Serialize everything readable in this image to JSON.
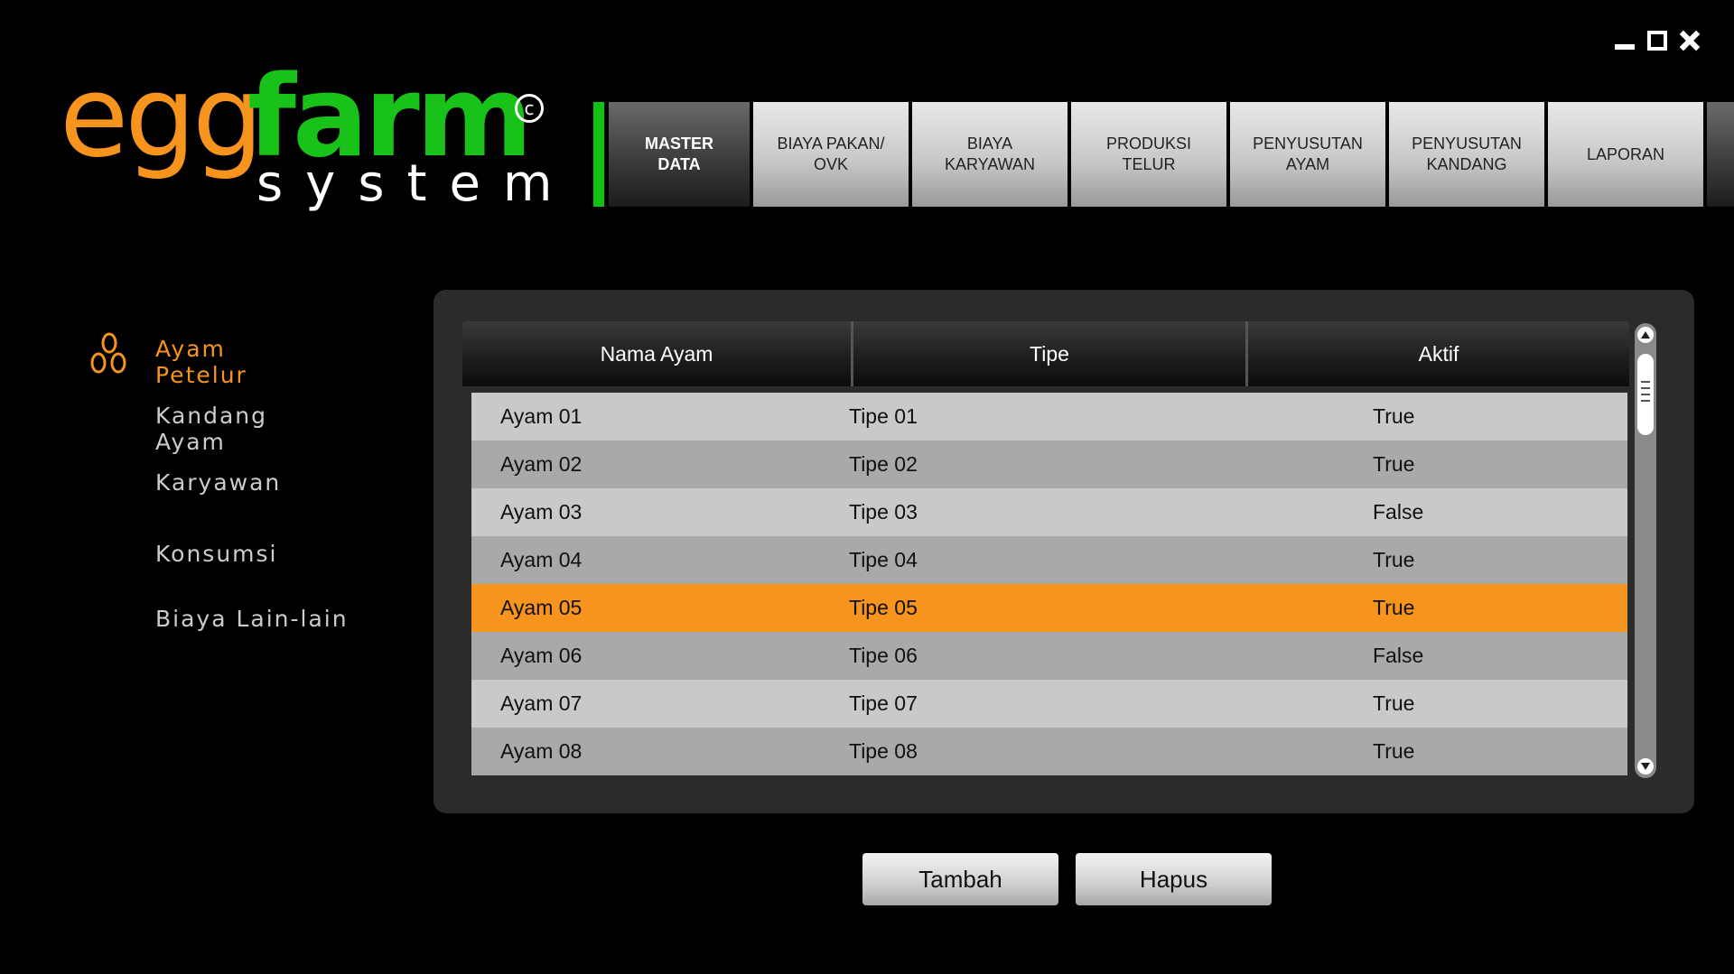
{
  "window": {
    "controls": [
      {
        "name": "minimize-icon"
      },
      {
        "name": "maximize-icon"
      },
      {
        "name": "close-icon"
      }
    ]
  },
  "logo": {
    "part1": "egg",
    "part2": "farm",
    "part3": "system",
    "copyright": "c",
    "colors": {
      "egg": "#f7941d",
      "farm": "#19c219",
      "system": "#ffffff"
    }
  },
  "nav": {
    "tabs": [
      {
        "label": "MASTER\nDATA",
        "active": true
      },
      {
        "label": "BIAYA PAKAN/\nOVK",
        "active": false
      },
      {
        "label": "BIAYA\nKARYAWAN",
        "active": false
      },
      {
        "label": "PRODUKSI\nTELUR",
        "active": false
      },
      {
        "label": "PENYUSUTAN\nAYAM",
        "active": false
      },
      {
        "label": "PENYUSUTAN\nKANDANG",
        "active": false
      },
      {
        "label": "LAPORAN",
        "active": false
      }
    ],
    "accent_color": "#11c211"
  },
  "sidebar": {
    "items": [
      {
        "label": "Ayam Petelur",
        "active": true,
        "icon": "eggs-icon"
      },
      {
        "label": "Kandang Ayam",
        "active": false
      },
      {
        "label": "Karyawan",
        "active": false
      },
      {
        "label": "Konsumsi",
        "active": false
      },
      {
        "label": "Biaya Lain-lain",
        "active": false
      }
    ]
  },
  "table": {
    "columns": [
      "Nama Ayam",
      "Tipe",
      "Aktif"
    ],
    "rows": [
      {
        "nama": "Ayam 01",
        "tipe": "Tipe 01",
        "aktif": "True"
      },
      {
        "nama": "Ayam 02",
        "tipe": "Tipe 02",
        "aktif": "True"
      },
      {
        "nama": "Ayam 03",
        "tipe": "Tipe 03",
        "aktif": "False"
      },
      {
        "nama": "Ayam 04",
        "tipe": "Tipe 04",
        "aktif": "True"
      },
      {
        "nama": "Ayam 05",
        "tipe": "Tipe 05",
        "aktif": "True",
        "selected": true
      },
      {
        "nama": "Ayam 06",
        "tipe": "Tipe 06",
        "aktif": "False"
      },
      {
        "nama": "Ayam 07",
        "tipe": "Tipe 07",
        "aktif": "True"
      },
      {
        "nama": "Ayam 08",
        "tipe": "Tipe 08",
        "aktif": "True"
      }
    ],
    "selected_color": "#f7941d"
  },
  "buttons": {
    "add": "Tambah",
    "delete": "Hapus"
  }
}
